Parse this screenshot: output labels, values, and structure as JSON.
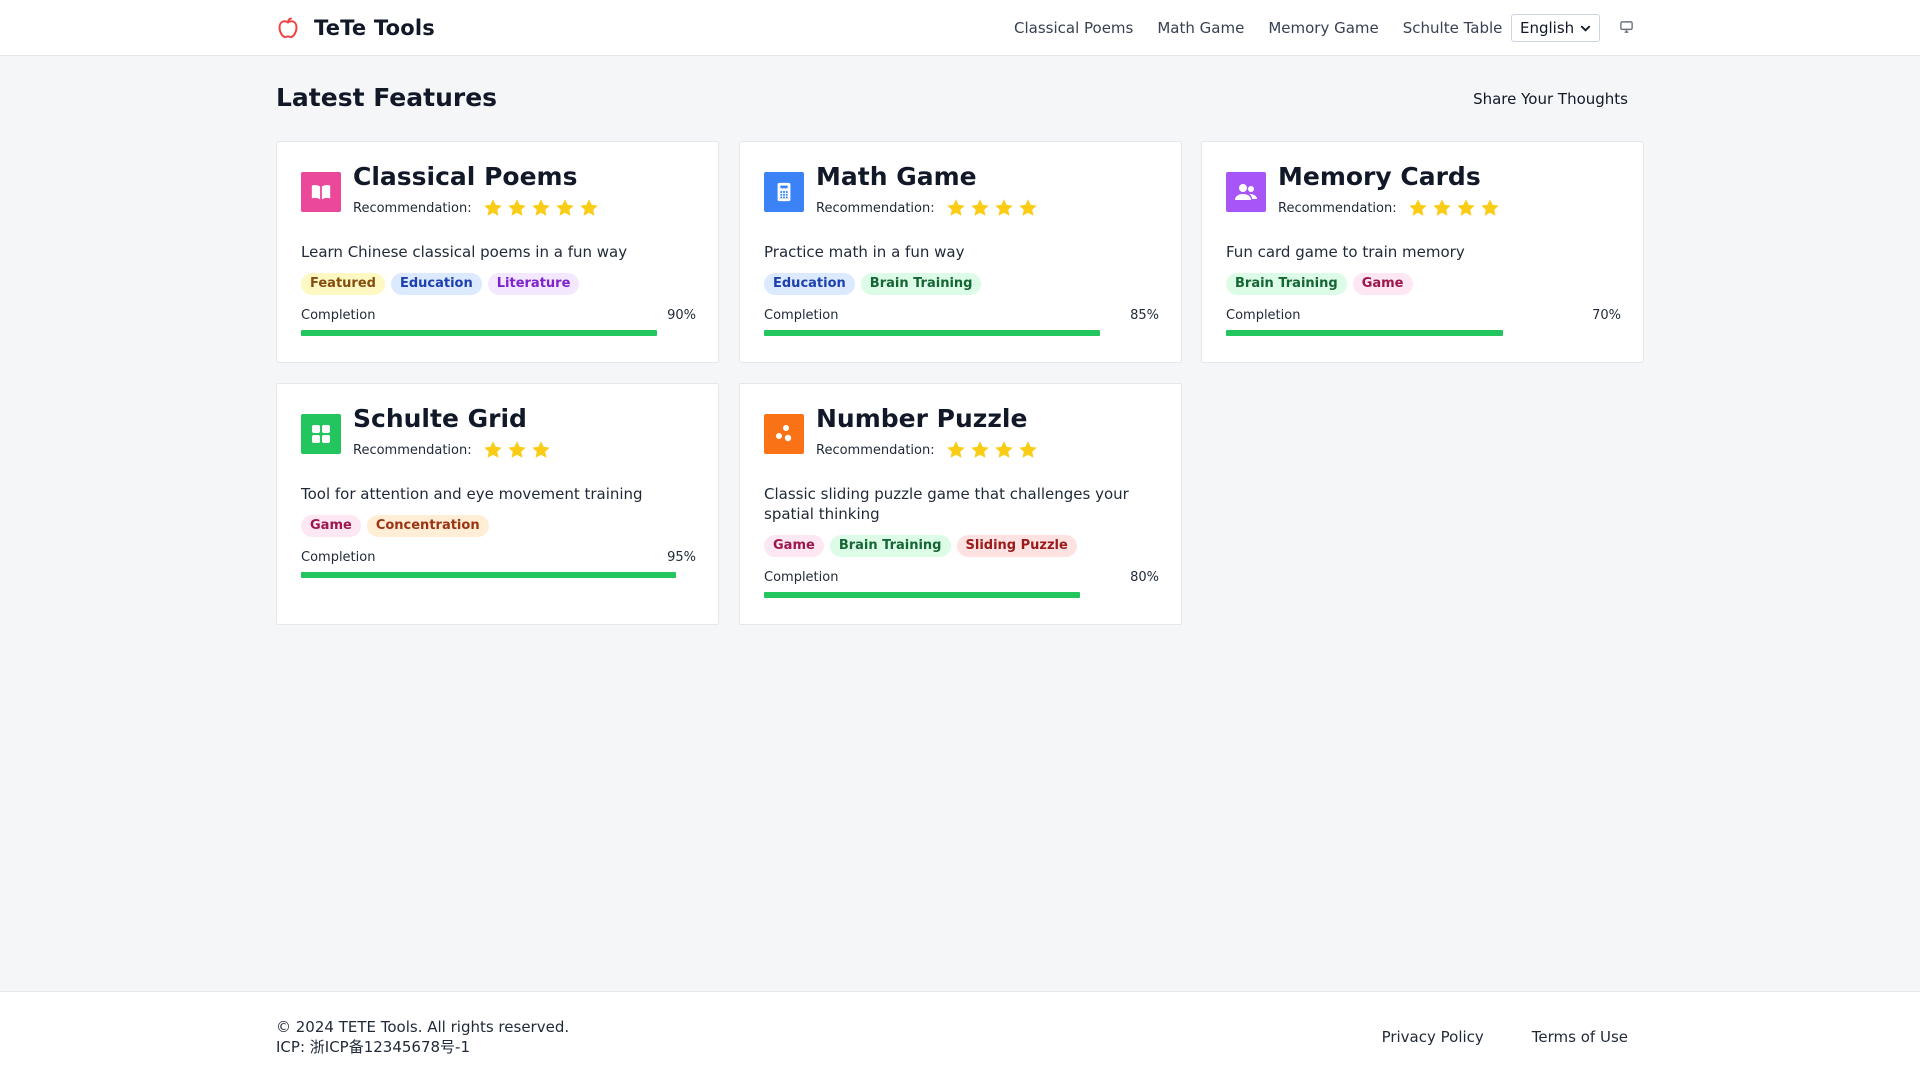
{
  "header": {
    "brand": "TeTe Tools",
    "nav": [
      "Classical Poems",
      "Math Game",
      "Memory Game",
      "Schulte Table"
    ],
    "language": "English",
    "theme_icon": "monitor-icon",
    "logo_icon": "apple-icon",
    "logo_color": "#ef4444"
  },
  "main": {
    "title": "Latest Features",
    "share": "Share Your Thoughts",
    "rec_label": "Recommendation:",
    "completion_label": "Completion",
    "cards": [
      {
        "title": "Classical Poems",
        "icon": "book-open-icon",
        "icon_color": "#ec4899",
        "rating": 5,
        "desc": "Learn Chinese classical poems in a fun way",
        "tags": [
          "Featured",
          "Education",
          "Literature"
        ],
        "completion": 90,
        "completion_text": "90%"
      },
      {
        "title": "Math Game",
        "icon": "calculator-icon",
        "icon_color": "#3b82f6",
        "rating": 4,
        "desc": "Practice math in a fun way",
        "tags": [
          "Education",
          "Brain Training"
        ],
        "completion": 85,
        "completion_text": "85%"
      },
      {
        "title": "Memory Cards",
        "icon": "users-icon",
        "icon_color": "#a855f7",
        "rating": 4,
        "desc": "Fun card game to train memory",
        "tags": [
          "Brain Training",
          "Game"
        ],
        "completion": 70,
        "completion_text": "70%"
      },
      {
        "title": "Schulte Grid",
        "icon": "grid-icon",
        "icon_color": "#22c55e",
        "rating": 3,
        "desc": "Tool for attention and eye movement training",
        "tags": [
          "Game",
          "Concentration"
        ],
        "completion": 95,
        "completion_text": "95%"
      },
      {
        "title": "Number Puzzle",
        "icon": "puzzle-icon",
        "icon_color": "#f97316",
        "rating": 4,
        "desc": "Classic sliding puzzle game that challenges your spatial thinking",
        "tags": [
          "Game",
          "Brain Training",
          "Sliding Puzzle"
        ],
        "completion": 80,
        "completion_text": "80%"
      }
    ],
    "tag_colors": {
      "Featured": [
        "#fef9c3",
        "#854d0e"
      ],
      "Education": [
        "#dbeafe",
        "#1e40af"
      ],
      "Literature": [
        "#f3e8ff",
        "#7e22ce"
      ],
      "Brain Training": [
        "#dcfce7",
        "#166534"
      ],
      "Game": [
        "#fce7f3",
        "#9d174d"
      ],
      "Concentration": [
        "#ffedd5",
        "#9a3412"
      ],
      "Sliding Puzzle": [
        "#fee2e2",
        "#991b1b"
      ]
    }
  },
  "footer": {
    "copyright": "© 2024 TETE Tools. All rights reserved.",
    "icp": "ICP: 浙ICP备12345678号-1",
    "links": [
      "Privacy Policy",
      "Terms of Use"
    ]
  }
}
